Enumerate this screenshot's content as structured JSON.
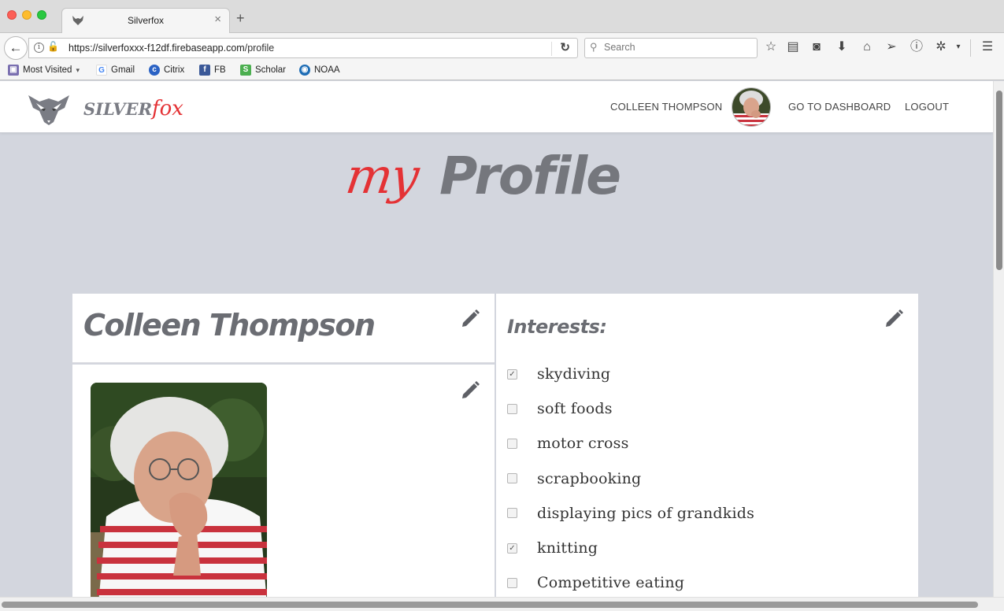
{
  "browser": {
    "tab_title": "Silverfox",
    "tab_close": "×",
    "new_tab": "+",
    "url_host": "https://silverfoxxx-f12df.firebaseapp.com",
    "url_path": "/profile",
    "search_placeholder": "Search",
    "bookmarks": [
      {
        "label": "Most Visited",
        "icon": "folder-icon"
      },
      {
        "label": "Gmail",
        "icon": "google-icon"
      },
      {
        "label": "Citrix",
        "icon": "citrix-icon"
      },
      {
        "label": "FB",
        "icon": "facebook-icon"
      },
      {
        "label": "Scholar",
        "icon": "scholar-icon"
      },
      {
        "label": "NOAA",
        "icon": "noaa-icon"
      }
    ]
  },
  "header": {
    "brand_silver": "SILVER",
    "brand_fox": "fox",
    "user_name": "COLLEEN THOMPSON",
    "dashboard_link": "GO TO DASHBOARD",
    "logout_link": "LOGOUT"
  },
  "hero": {
    "my": "my",
    "profile": "Profile"
  },
  "profile": {
    "name": "Colleen Thompson",
    "interests_title": "Interests:",
    "interests": [
      {
        "label": "skydiving",
        "checked": true
      },
      {
        "label": "soft foods",
        "checked": false
      },
      {
        "label": "motor cross",
        "checked": false
      },
      {
        "label": "scrapbooking",
        "checked": false
      },
      {
        "label": "displaying pics of grandkids",
        "checked": false
      },
      {
        "label": "knitting",
        "checked": true
      },
      {
        "label": "Competitive eating",
        "checked": false
      }
    ]
  },
  "colors": {
    "accent_red": "#e43235",
    "heading_gray": "#6b6d73",
    "page_bg": "#d3d6de"
  }
}
